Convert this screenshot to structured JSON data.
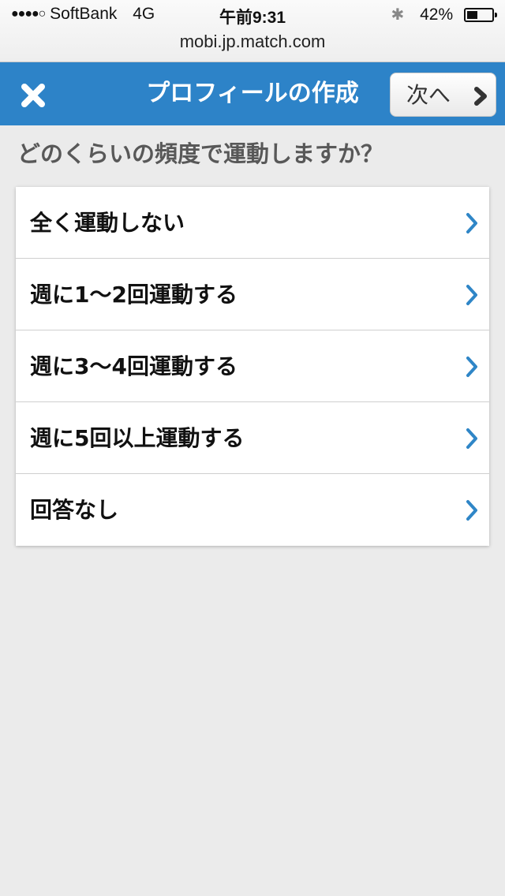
{
  "status_bar": {
    "signal_dots": "●●●●○",
    "carrier": "SoftBank",
    "network": "4G",
    "time": "午前9:31",
    "bluetooth_icon": "bluetooth-icon",
    "battery_text": "42%",
    "battery_level": 0.42
  },
  "url": "mobi.jp.match.com",
  "navbar": {
    "background_color": "#2d83c8",
    "close_icon": "close-icon",
    "title": "プロフィールの作成",
    "next_label": "次へ",
    "next_icon": "chevron-right-icon"
  },
  "question": "どのくらいの頻度で運動しますか？",
  "options": [
    {
      "label": "全く運動しない"
    },
    {
      "label": "週に1〜2回運動する"
    },
    {
      "label": "週に3〜4回運動する"
    },
    {
      "label": "週に5回以上運動する"
    },
    {
      "label": "回答なし"
    }
  ],
  "colors": {
    "accent_blue": "#2d83c8",
    "chevron_blue": "#2f86c7"
  }
}
